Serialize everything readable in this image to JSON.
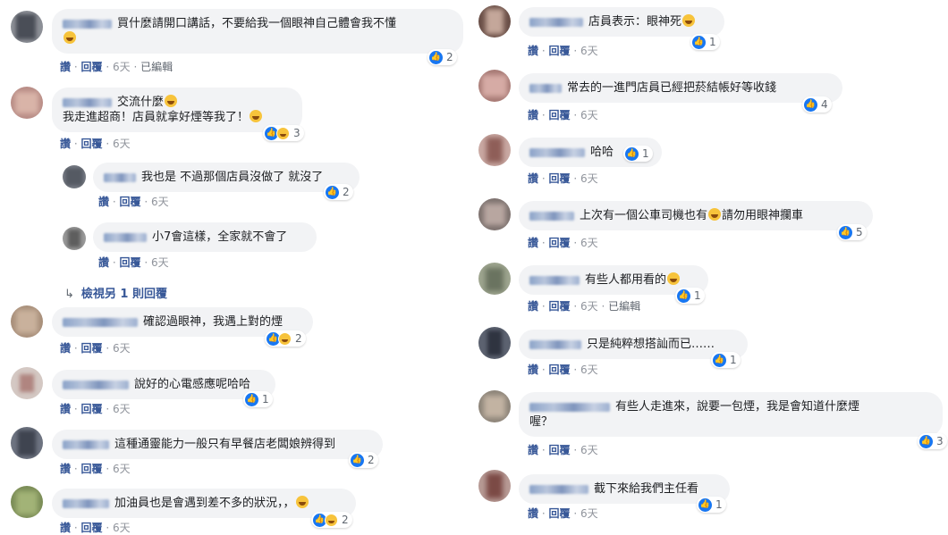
{
  "ui": {
    "like": "讚",
    "reply": "回覆",
    "sep": "·",
    "edited": "已編輯"
  },
  "left": [
    {
      "text": "買什麼請開口講話，不要給我一個眼神自己體會我不懂",
      "time": "6天",
      "edited": true,
      "likes": "2",
      "react": "like"
    },
    {
      "text": "交流什麼",
      "text2": "我走進超商！店員就拿好煙等我了！",
      "time": "6天",
      "likes": "3",
      "react": "likehaha"
    },
    {
      "text": "我也是 不過那個店員沒做了 就沒了",
      "time": "6天",
      "likes": "2",
      "react": "like",
      "reply": true
    },
    {
      "text": "小7會這樣，全家就不會了",
      "time": "6天",
      "reply": true
    },
    {
      "more": "檢視另 1 則回覆"
    },
    {
      "text": "確認過眼神，我遇上對的煙",
      "time": "6天",
      "likes": "2",
      "react": "likehaha"
    },
    {
      "text": "說好的心電感應呢哈哈",
      "time": "6天",
      "likes": "1",
      "react": "like"
    },
    {
      "text": "這種通靈能力一般只有早餐店老闆娘辨得到",
      "time": "6天",
      "likes": "2",
      "react": "like"
    },
    {
      "text": "加油員也是會遇到差不多的狀況，，",
      "time": "6天",
      "likes": "2",
      "react": "likehaha"
    }
  ],
  "right": [
    {
      "text": "店員表示：眼神死",
      "time": "6天",
      "likes": "1",
      "react": "like"
    },
    {
      "text": "常去的一進門店員已經把菸結帳好等收錢",
      "time": "6天",
      "likes": "4",
      "react": "like"
    },
    {
      "text": "哈哈",
      "time": "6天",
      "likes": "1",
      "react": "like"
    },
    {
      "text": "上次有一個公車司機也有",
      "text_b": "請勿用眼神攔車",
      "time": "6天",
      "likes": "5",
      "react": "like"
    },
    {
      "text": "有些人都用看的",
      "time": "6天",
      "edited": true,
      "likes": "1",
      "react": "like"
    },
    {
      "text": "只是純粹想搭訕而已……",
      "time": "6天",
      "likes": "1",
      "react": "like"
    },
    {
      "text": "有些人走進來，說要一包煙，我是會知道什麼煙",
      "text2": "喔？",
      "time": "6天",
      "likes": "3",
      "react": "like"
    },
    {
      "text": "截下來給我們主任看",
      "time": "6天",
      "likes": "1",
      "react": "like"
    }
  ]
}
